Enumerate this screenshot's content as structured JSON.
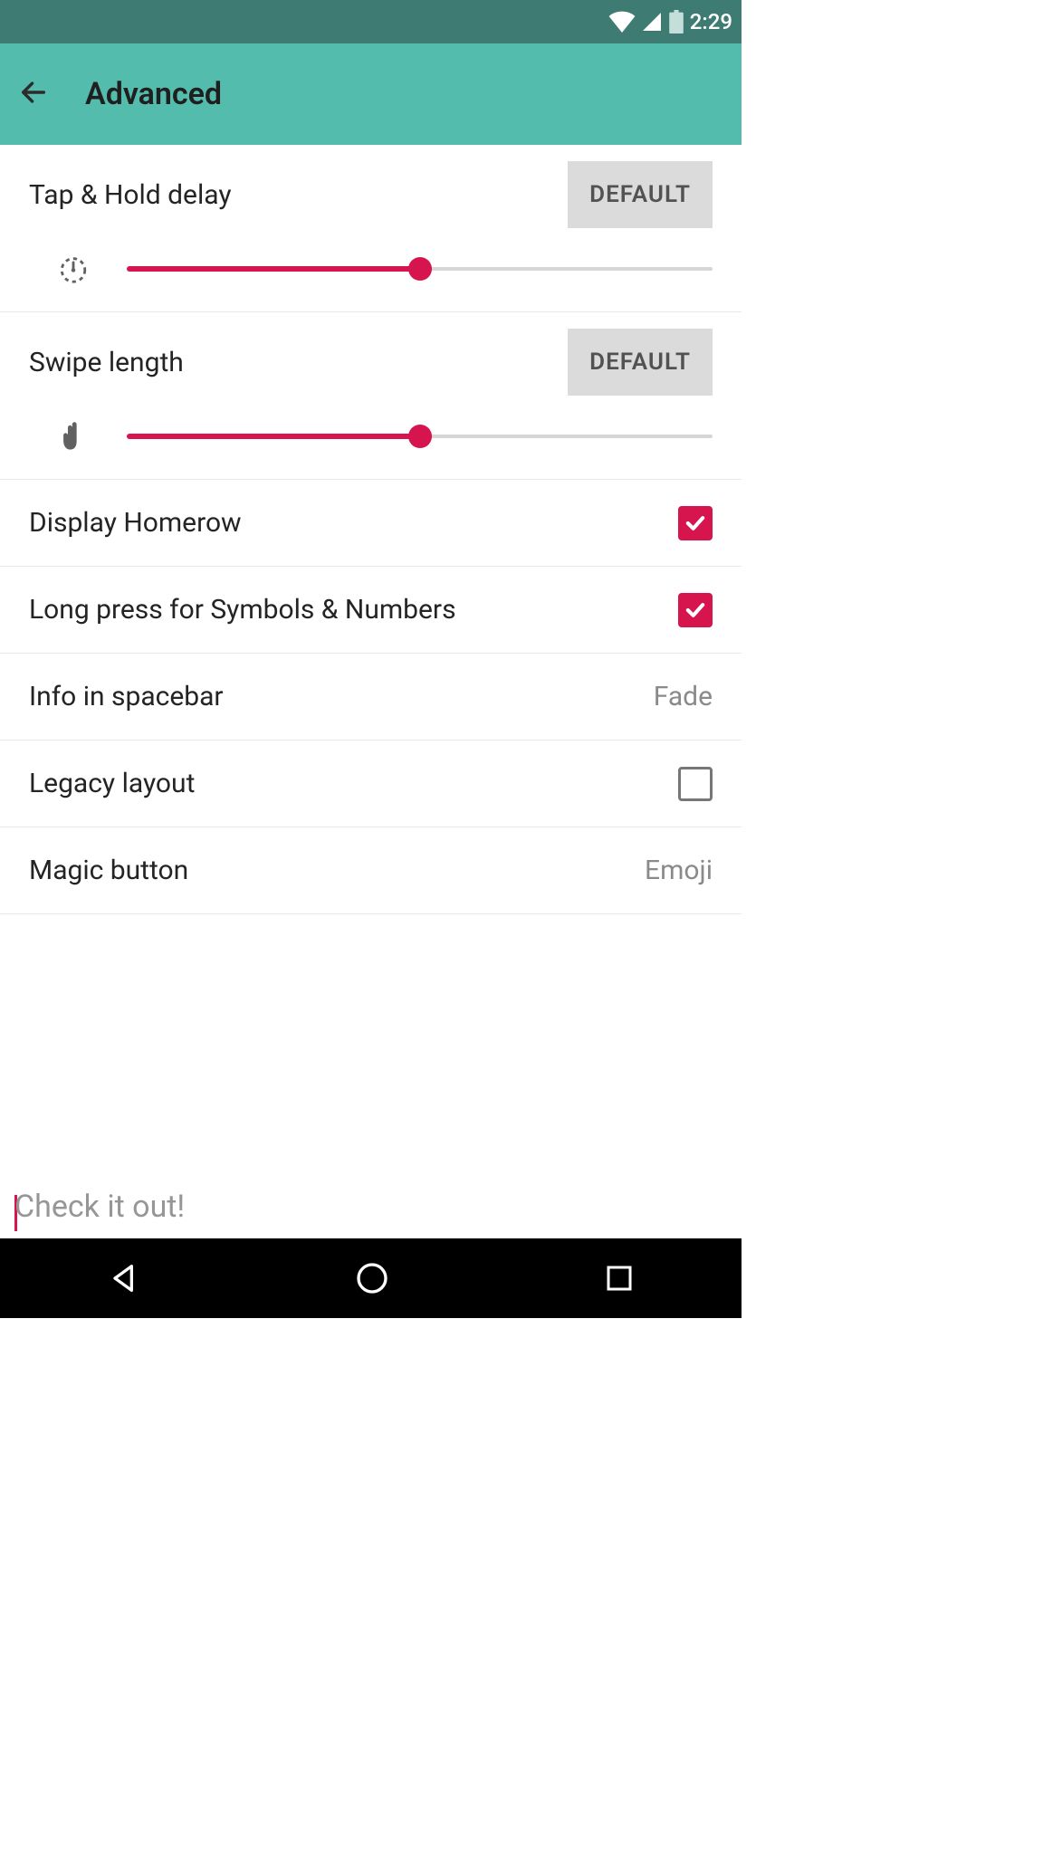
{
  "status": {
    "time": "2:29"
  },
  "header": {
    "title": "Advanced"
  },
  "settings": {
    "tapHold": {
      "label": "Tap & Hold delay",
      "button": "DEFAULT",
      "value": 50
    },
    "swipe": {
      "label": "Swipe length",
      "button": "DEFAULT",
      "value": 50
    },
    "homerow": {
      "label": "Display Homerow",
      "checked": true
    },
    "longpress": {
      "label": "Long press for Symbols & Numbers",
      "checked": true
    },
    "spacebar": {
      "label": "Info in spacebar",
      "value": "Fade"
    },
    "legacy": {
      "label": "Legacy layout",
      "checked": false
    },
    "magic": {
      "label": "Magic button",
      "value": "Emoji"
    }
  },
  "footer": {
    "placeholder": "Check it out!"
  },
  "colors": {
    "accent": "#d6144d",
    "appbar": "#54bcac",
    "statusbar": "#3e7b73"
  }
}
